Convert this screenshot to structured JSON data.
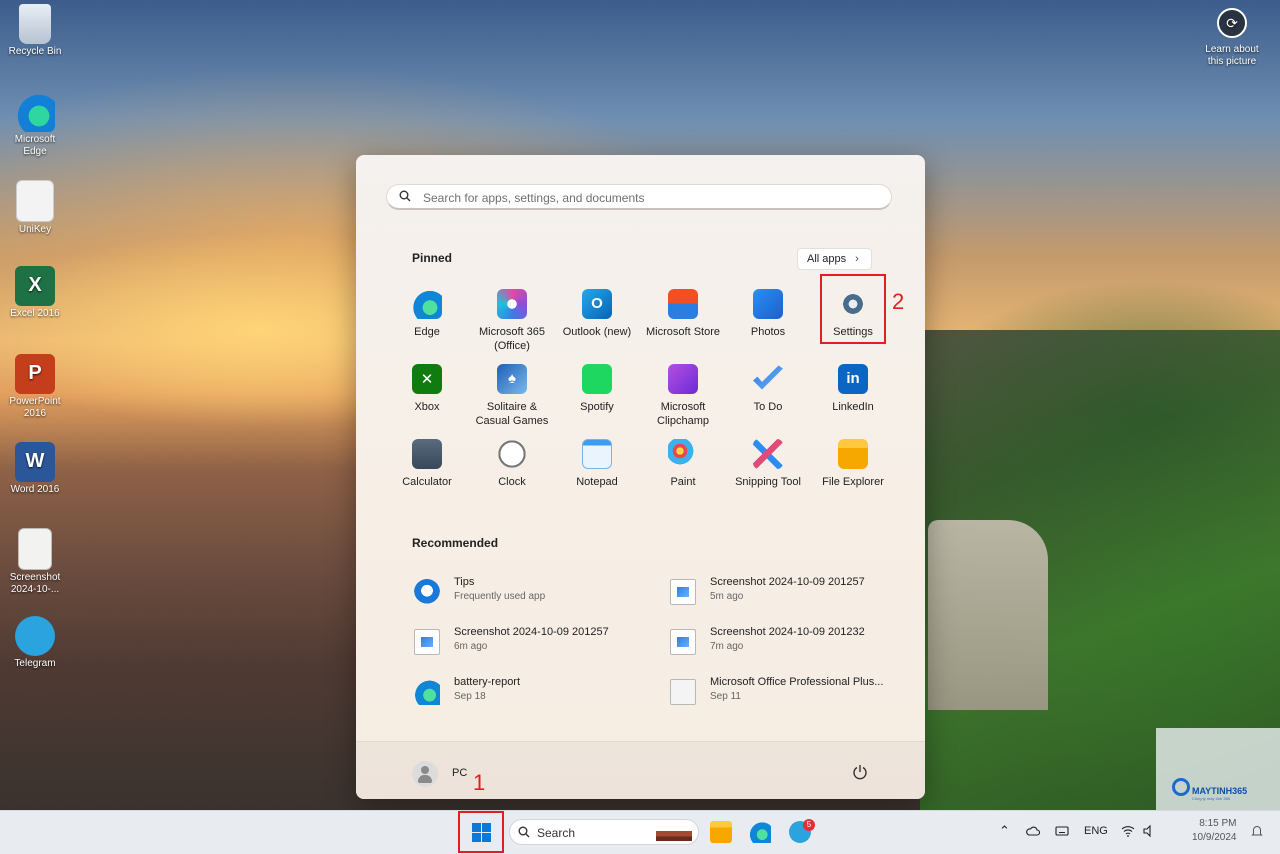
{
  "desktop": {
    "icons": [
      {
        "label": "Recycle Bin"
      },
      {
        "label": "Microsoft Edge"
      },
      {
        "label": "UniKey"
      },
      {
        "label": "Excel 2016"
      },
      {
        "label": "PowerPoint 2016"
      },
      {
        "label": "Word 2016"
      },
      {
        "label": "Screenshot 2024-10-..."
      },
      {
        "label": "Telegram"
      }
    ],
    "learn_about": {
      "line1": "Learn about",
      "line2": "this picture"
    }
  },
  "start_menu": {
    "search_placeholder": "Search for apps, settings, and documents",
    "pinned_title": "Pinned",
    "all_apps_label": "All apps",
    "pinned": [
      {
        "name": "Edge",
        "icon": "edge-icon"
      },
      {
        "name": "Microsoft 365 (Office)",
        "icon": "microsoft-365-icon"
      },
      {
        "name": "Outlook (new)",
        "icon": "outlook-icon"
      },
      {
        "name": "Microsoft Store",
        "icon": "store-icon"
      },
      {
        "name": "Photos",
        "icon": "photos-icon"
      },
      {
        "name": "Settings",
        "icon": "settings-gear-icon"
      },
      {
        "name": "Xbox",
        "icon": "xbox-icon"
      },
      {
        "name": "Solitaire & Casual Games",
        "icon": "solitaire-icon"
      },
      {
        "name": "Spotify",
        "icon": "spotify-icon"
      },
      {
        "name": "Microsoft Clipchamp",
        "icon": "clipchamp-icon"
      },
      {
        "name": "To Do",
        "icon": "todo-icon"
      },
      {
        "name": "LinkedIn",
        "icon": "linkedin-icon"
      },
      {
        "name": "Calculator",
        "icon": "calculator-icon"
      },
      {
        "name": "Clock",
        "icon": "clock-icon"
      },
      {
        "name": "Notepad",
        "icon": "notepad-icon"
      },
      {
        "name": "Paint",
        "icon": "paint-icon"
      },
      {
        "name": "Snipping Tool",
        "icon": "snipping-tool-icon"
      },
      {
        "name": "File Explorer",
        "icon": "file-explorer-icon"
      }
    ],
    "recommended_title": "Recommended",
    "recommended": [
      {
        "name": "Tips",
        "sub": "Frequently used app"
      },
      {
        "name": "Screenshot 2024-10-09 201257",
        "sub": "5m ago"
      },
      {
        "name": "Screenshot 2024-10-09 201257",
        "sub": "6m ago"
      },
      {
        "name": "Screenshot 2024-10-09 201232",
        "sub": "7m ago"
      },
      {
        "name": "battery-report",
        "sub": "Sep 18"
      },
      {
        "name": "Microsoft Office Professional Plus...",
        "sub": "Sep 11"
      }
    ],
    "user_name": "PC"
  },
  "annotations": {
    "marker1": "1",
    "marker2": "2",
    "highlight_color": "#e02020"
  },
  "taskbar": {
    "search_label": "Search",
    "telegram_badge": "5",
    "language": "ENG",
    "time": "8:15 PM",
    "date": "10/9/2024"
  },
  "watermark": {
    "brand": "MAYTINH365",
    "tagline": "Công ty máy tính 365"
  }
}
